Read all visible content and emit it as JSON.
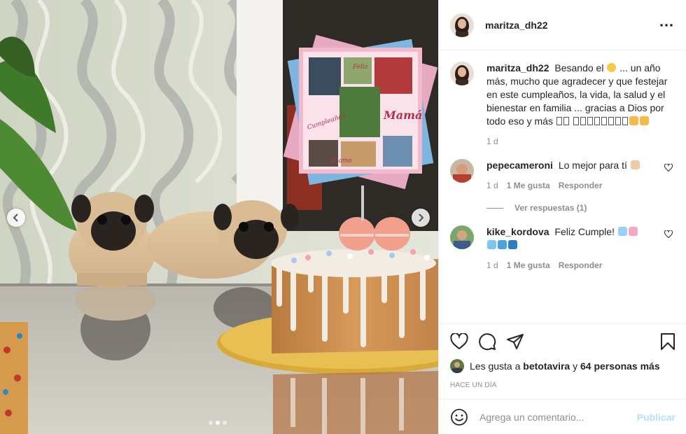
{
  "post": {
    "username": "maritza_dh22",
    "caption": {
      "username": "maritza_dh22",
      "text_part1": "Besando el",
      "text_part2": "... un año más, mucho que agradecer y que festejar en este cumpleaños, la vida, la salud y el bienestar en familia ... gracias a Dios por todo eso y más",
      "time": "1 d"
    },
    "comments": [
      {
        "username": "pepecameroni",
        "text": "Lo mejor para tí",
        "time": "1 d",
        "likes": "1 Me gusta",
        "reply": "Responder",
        "view_replies": "Ver respuestas (1)"
      },
      {
        "username": "kike_kordova",
        "text": "Feliz Cumple!",
        "time": "1 d",
        "likes": "1 Me gusta",
        "reply": "Responder"
      }
    ],
    "likes_prefix": "Les gusta a",
    "likes_user": "betotavira",
    "likes_connector": "y",
    "likes_others": "64 personas más",
    "time_ago": "HACE UN DÍA",
    "comment_placeholder": "Agrega un comentario...",
    "publish_label": "Publicar"
  },
  "photo": {
    "topper_texts": [
      "Feliz",
      "Cumpleaños",
      "Mamá",
      "Te amo"
    ],
    "carousel_total": 3,
    "carousel_active": 2
  },
  "icons": {
    "more": "more-horizontal-icon",
    "like": "heart-icon",
    "comment": "comment-bubble-icon",
    "share": "paper-plane-icon",
    "save": "bookmark-icon",
    "emoji": "smiley-icon",
    "prev": "chevron-left-icon",
    "next": "chevron-right-icon"
  },
  "colors": {
    "text": "#262626",
    "muted": "#8e8e8e",
    "publish_disabled": "#b2dffc",
    "border": "#efefef"
  }
}
